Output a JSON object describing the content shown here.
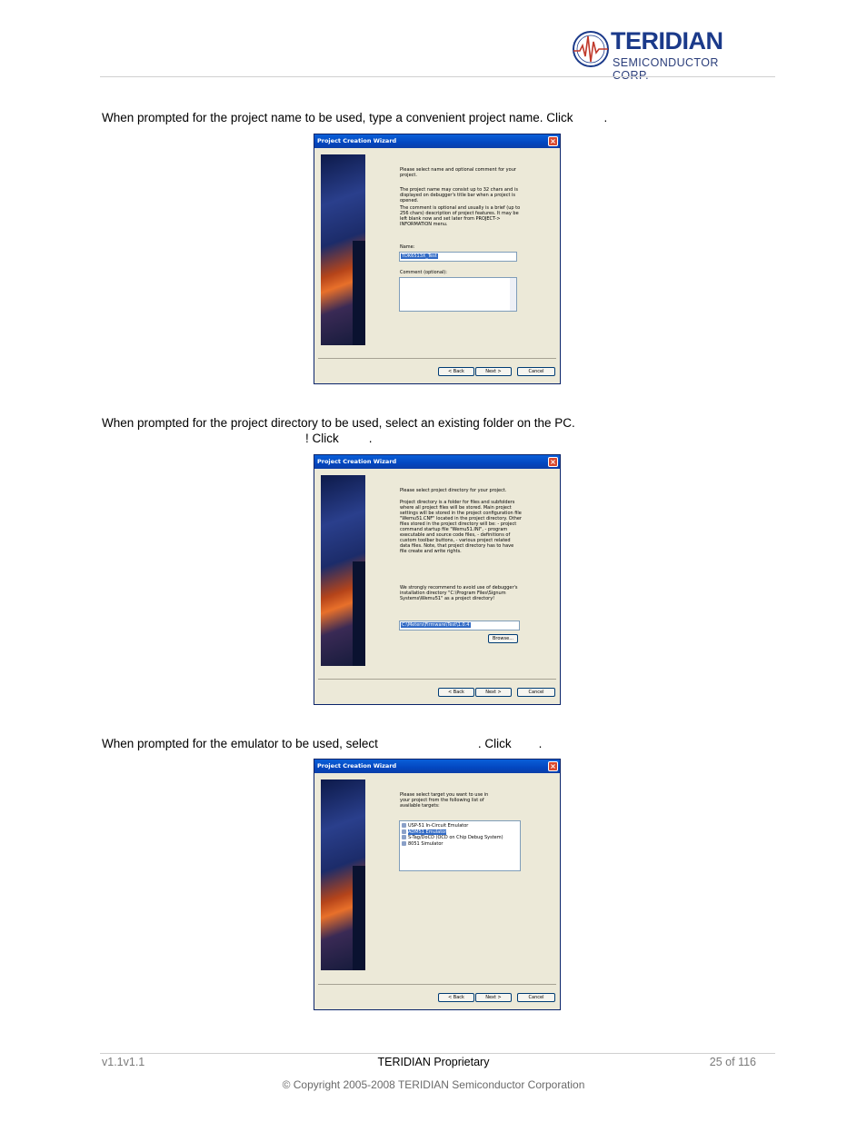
{
  "header": {
    "brand": "TERIDIAN",
    "subtitle": "SEMICONDUCTOR CORP."
  },
  "steps": [
    {
      "line1": "When prompted for the project name to be used, type a convenient project name. Click",
      "line1_end": ".",
      "dialog": {
        "title": "Project Creation Wizard",
        "paragraphs": [
          "Please select name and optional comment for your project.",
          "The project name may consist up to 32 chars and is displayed on debugger's title bar when a project is opened.",
          "The comment is optional and usually is a brief (up to 256 chars) description of project features. It may be left blank now and set later from PROJECT-> INFORMATION menu."
        ],
        "name_label": "Name:",
        "name_value": "TDK6513X_Test",
        "comment_label": "Comment (optional):",
        "back": "< Back",
        "next": "Next >",
        "cancel": "Cancel"
      }
    },
    {
      "line1": "When prompted for the project directory to be used, select an existing folder on the PC.",
      "line2": "! Click",
      "line2_end": ".",
      "dialog": {
        "title": "Project Creation Wizard",
        "paragraphs": [
          "Please select project directory for your project.",
          "Project directory is a folder for files and subfolders where all project files will be stored. Main project settings will be stored in the project configuration file \"Wemu51.CNF\" located in the project directory. Other files stored in the project directory will be: - project command startup file \"Wemu51.INI\", - program executable and source code files, - definitions of custom toolbar buttons, - various project related data files. Note, that project directory has to have file create and write rights.",
          "We strongly recommend to avoid use of debugger's installation directory \"C:\\Program Files\\Signum Systems\\Wemu51\" as a project directory!"
        ],
        "dir_value": "C:\\Meters\\Firmware\\Test\\1.0.4",
        "browse": "Browse...",
        "back": "< Back",
        "next": "Next >",
        "cancel": "Cancel"
      }
    },
    {
      "line1": "When prompted for the emulator to be used, select",
      "line1_mid": ". Click",
      "line1_end": ".",
      "dialog": {
        "title": "Project Creation Wizard",
        "paragraphs": [
          "Please select target you want to use in your project from the following list of available targets:"
        ],
        "targets": [
          "USP-51 In-Circuit Emulator",
          "ADM51 Emulator",
          "S-Tag/DoCD (OCD on Chip Debug System)",
          "8051 Simulator"
        ],
        "selected_target": "ADM51 Emulator",
        "back": "< Back",
        "next": "Next >",
        "cancel": "Cancel"
      }
    }
  ],
  "footer": {
    "version": "v1.1v1.1",
    "center": "TERIDIAN Proprietary",
    "page": "25 of 116",
    "copyright": "© Copyright 2005-2008 TERIDIAN Semiconductor Corporation"
  }
}
